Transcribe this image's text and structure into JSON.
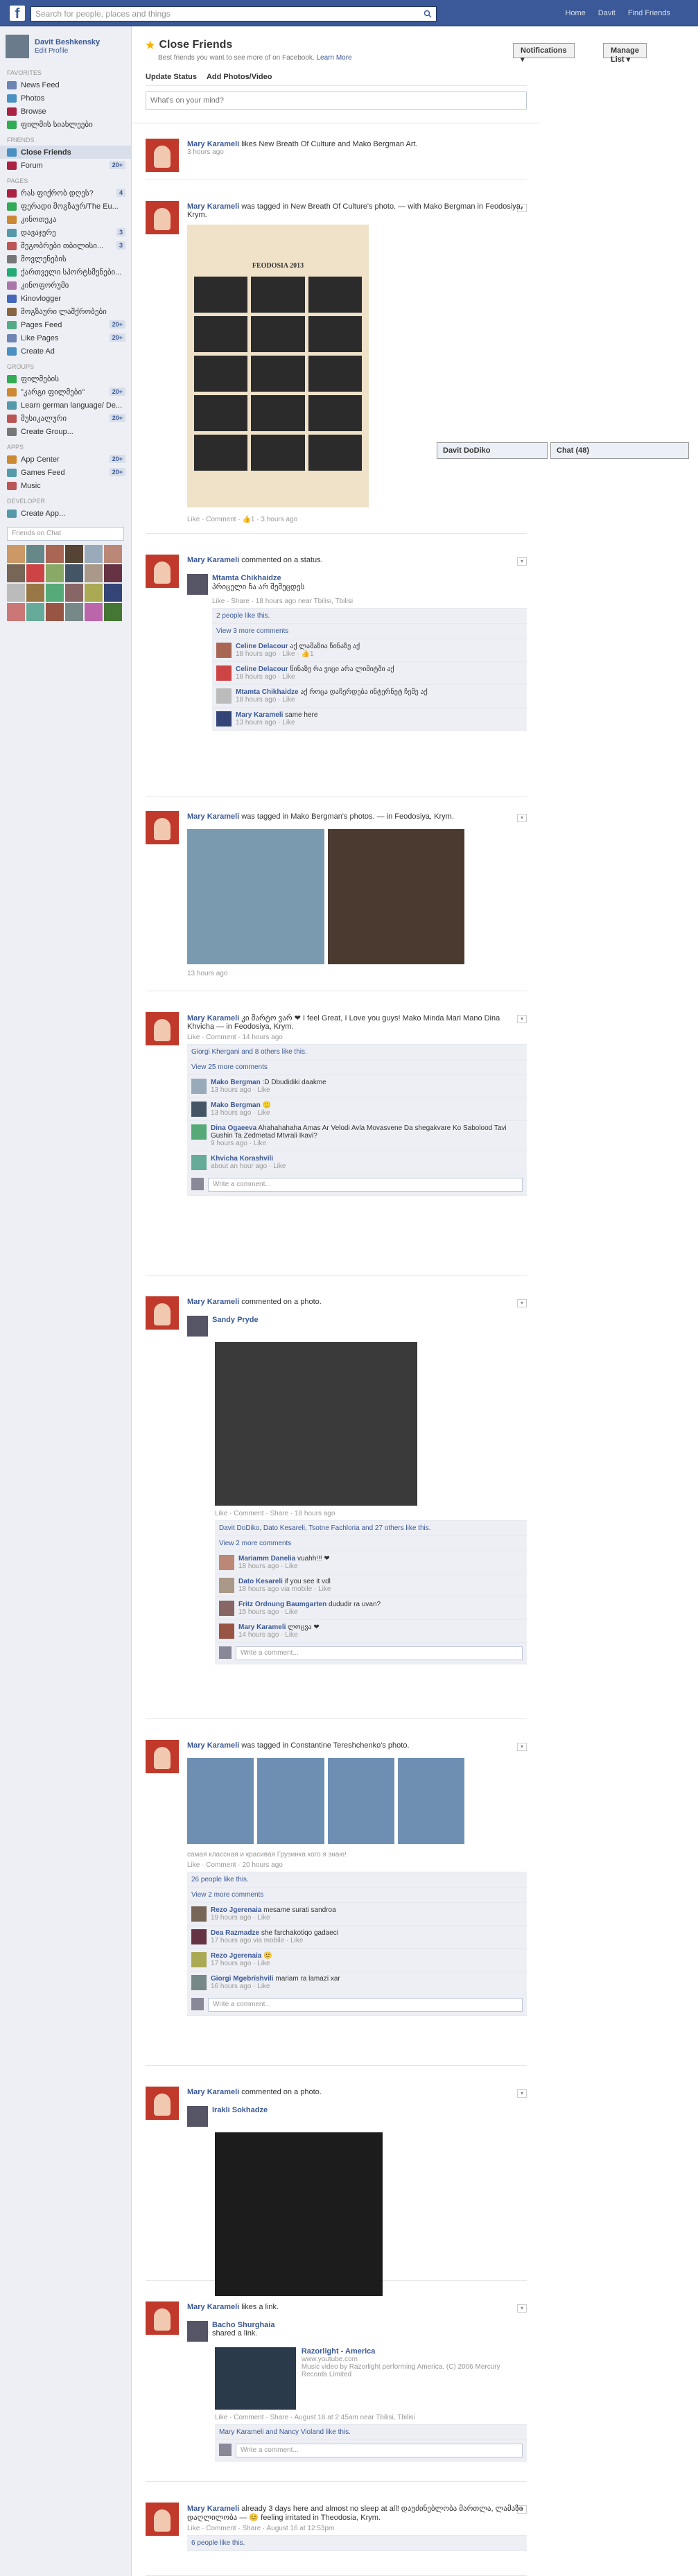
{
  "topbar": {
    "logo": "f",
    "search_placeholder": "Search for people, places and things",
    "links": [
      "Home",
      "Davit",
      "Find Friends"
    ]
  },
  "sidebar": {
    "profile": {
      "name": "Davit Beshkensky",
      "edit": "Edit Profile"
    },
    "favorites_label": "FAVORITES",
    "favorites": [
      {
        "label": "News Feed",
        "count": ""
      },
      {
        "label": "Photos",
        "count": ""
      },
      {
        "label": "Browse",
        "count": ""
      },
      {
        "label": "ფილმის სიახლეები",
        "count": ""
      }
    ],
    "friends_label": "FRIENDS",
    "friends": [
      {
        "label": "Close Friends",
        "count": ""
      },
      {
        "label": "Forum",
        "count": "20+"
      }
    ],
    "pages_label": "PAGES",
    "pages": [
      {
        "label": "რას ფიქრობ დღეს?",
        "count": "4"
      },
      {
        "label": "ფერადი მოგზაურ/The Eu...",
        "count": ""
      },
      {
        "label": "კინოთეკა",
        "count": ""
      },
      {
        "label": "დავაჯერე",
        "count": "3"
      },
      {
        "label": "მეგობრები თბილისი...",
        "count": "3"
      },
      {
        "label": "მოვლენების",
        "count": ""
      },
      {
        "label": "ქართველი სპორტსმენები...",
        "count": ""
      },
      {
        "label": "კინოფორუმი",
        "count": ""
      },
      {
        "label": "Kinovlogger",
        "count": ""
      },
      {
        "label": "მოგზაური ლაშქრობები",
        "count": ""
      },
      {
        "label": "Pages Feed",
        "count": "20+"
      },
      {
        "label": "Like Pages",
        "count": "20+"
      },
      {
        "label": "Create Ad",
        "count": ""
      }
    ],
    "groups_label": "GROUPS",
    "groups": [
      {
        "label": "ფილმების",
        "count": ""
      },
      {
        "label": "\"კარგი ფილმები\"",
        "count": "20+"
      },
      {
        "label": "Learn german language/ De...",
        "count": ""
      },
      {
        "label": "მუსიკალური",
        "count": "20+"
      },
      {
        "label": "Create Group...",
        "count": ""
      }
    ],
    "apps_label": "APPS",
    "apps": [
      {
        "label": "App Center",
        "count": "20+"
      },
      {
        "label": "Games Feed",
        "count": "20+"
      },
      {
        "label": "Music",
        "count": ""
      }
    ],
    "developer_label": "DEVELOPER",
    "developer": [
      {
        "label": "Create App...",
        "count": ""
      }
    ],
    "chat_search_placeholder": "Friends on Chat"
  },
  "header": {
    "title": "Close Friends",
    "subtitle": "Best friends you want to see more of on Facebook.",
    "learn_more": "Learn More",
    "notifications_btn": "Notifications",
    "manage_btn": "Manage List",
    "update_status": "Update Status",
    "add_photos": "Add Photos/Video",
    "whats_on_mind": "What's on your mind?"
  },
  "chatbar": {
    "friend": "Davit DoDiko",
    "chat": "Chat (48)"
  },
  "stories": [
    {
      "actor": "Mary Karameli",
      "text": "likes New Breath Of Culture and Mako Bergman Art.",
      "meta": "3 hours ago"
    },
    {
      "actor": "Mary Karameli",
      "text": "was tagged in New Breath Of Culture's photo. — with Mako Bergman in Feodosiya, Krym.",
      "poster_title": "FEODOSIA 2013",
      "meta": "Like · Comment · 👍1 · 3 hours ago"
    },
    {
      "actor": "Mary Karameli",
      "text": "commented on a status.",
      "sub_actor": "Mtamta Chikhaidze",
      "sub_text": "პრიცელი ჩა არ შემეცდეს",
      "sub_meta": "Like · Share · 18 hours ago near Tbilisi, Tbilisi",
      "likes": "2 people like this.",
      "view_more": "View 3 more comments",
      "comments": [
        {
          "name": "Celine Delacour",
          "text": "აქ ლამაზია წინაზე აქ",
          "meta": "18 hours ago · Like · 👍1"
        },
        {
          "name": "Celine Delacour",
          "text": "წინაზე რა ვიცი არა ლიმიტში აქ",
          "meta": "18 hours ago · Like"
        },
        {
          "name": "Mtamta Chikhaidze",
          "text": "აქ როცა დაჩერდება ინტერნეტ ჩემე აქ",
          "meta": "18 hours ago · Like"
        },
        {
          "name": "Mary Karameli",
          "text": "same here",
          "meta": "13 hours ago · Like"
        }
      ]
    },
    {
      "actor": "Mary Karameli",
      "text": "was tagged in Mako Bergman's photos. — in Feodosiya, Krym.",
      "meta": "13 hours ago"
    },
    {
      "actor": "Mary Karameli",
      "text": "კი მარტო ვარ ❤ I feel Great, I Love you guys! Mako Minda Mari Mano Dina Khvicha — in Feodosiya, Krym.",
      "meta": "Like · Comment · 14 hours ago",
      "likes": "Giorgi Khergani and 8 others like this.",
      "view_more": "View 25 more comments",
      "comments": [
        {
          "name": "Mako Bergman",
          "text": ":D Dbudidiki daakme",
          "meta": "13 hours ago · Like"
        },
        {
          "name": "Mako Bergman",
          "text": "🙂",
          "meta": "13 hours ago · Like"
        },
        {
          "name": "Dina Ogaeeva",
          "text": "Ahahahahaha Amas Ar Velodi Avla Movasvene Da shegakvare Ko Sabolood Tavi Gushin Ta Zedmetad Mtvrali Ikavi?",
          "meta": "9 hours ago · Like"
        },
        {
          "name": "Khvicha Korashvili",
          "text": "",
          "meta": "about an hour ago · Like"
        }
      ],
      "write": "Write a comment..."
    },
    {
      "actor": "Mary Karameli",
      "text": "commented on a photo.",
      "sub_actor": "Sandy Pryde",
      "sub_meta": "Like · Comment · Share · 18 hours ago",
      "likes": "Davit DoDiko, Dato Kesareli, Tsotne Fachloria and 27 others like this.",
      "view_more": "View 2 more comments",
      "comments": [
        {
          "name": "Mariamm Danelia",
          "text": "vuahh!!! ❤",
          "meta": "18 hours ago · Like"
        },
        {
          "name": "Dato Kesareli",
          "text": "if you see it vdl",
          "meta": "18 hours ago via mobile · Like"
        },
        {
          "name": "Fritz Ordnung Baumgarten",
          "text": "dududir ra uvan?",
          "meta": "15 hours ago · Like"
        },
        {
          "name": "Mary Karameli",
          "text": "ლოცვა ❤",
          "meta": "14 hours ago · Like"
        }
      ],
      "write": "Write a comment..."
    },
    {
      "actor": "Mary Karameli",
      "text": "was tagged in Constantine Tereshchenko's photo.",
      "caption": "самая классная и красивая Грузинка кого я знаю!",
      "meta": "Like · Comment · 20 hours ago",
      "likes": "26 people like this.",
      "view_more": "View 2 more comments",
      "comments": [
        {
          "name": "Rezo Jgerenaia",
          "text": "mesame surati sandroa",
          "meta": "19 hours ago · Like"
        },
        {
          "name": "Dea Razmadze",
          "text": "she farchakotiqo gadaeci",
          "meta": "17 hours ago via mobile · Like"
        },
        {
          "name": "Rezo Jgerenaia",
          "text": "🙂",
          "meta": "17 hours ago · Like"
        },
        {
          "name": "Giorgi Mgebrishvili",
          "text": "mariam ra lamazi xar",
          "meta": "16 hours ago · Like"
        }
      ],
      "write": "Write a comment..."
    },
    {
      "actor": "Mary Karameli",
      "text": "commented on a photo.",
      "sub_actor": "Irakli Sokhadze"
    },
    {
      "actor": "Mary Karameli",
      "text": "likes a link.",
      "sub_actor": "Bacho Shurghaia",
      "sub_text": "shared a link.",
      "link_title": "Razorlight - America",
      "link_domain": "www.youtube.com",
      "link_desc": "Music video by Razorlight performing America. (C) 2006 Mercury Records Limited",
      "sub_meta": "Like · Comment · Share · August 16 at 2:45am near Tbilisi, Tbilisi",
      "likes": "Mary Karameli and Nancy Violand like this.",
      "write": "Write a comment..."
    },
    {
      "actor": "Mary Karameli",
      "text": "already 3 days here and almost no sleep at all! დაუძინებლობა მართლა, ლამაზი დაღლილობა — 😊 feeling irritated in Theodosia, Krym.",
      "meta": "Like · Comment · Share · August 16 at 12:53pm",
      "likes": "6 people like this."
    }
  ],
  "colors": {
    "brand": "#3b5998",
    "sidebar_bg": "#edeff4",
    "comment_bg": "#edeff4"
  }
}
